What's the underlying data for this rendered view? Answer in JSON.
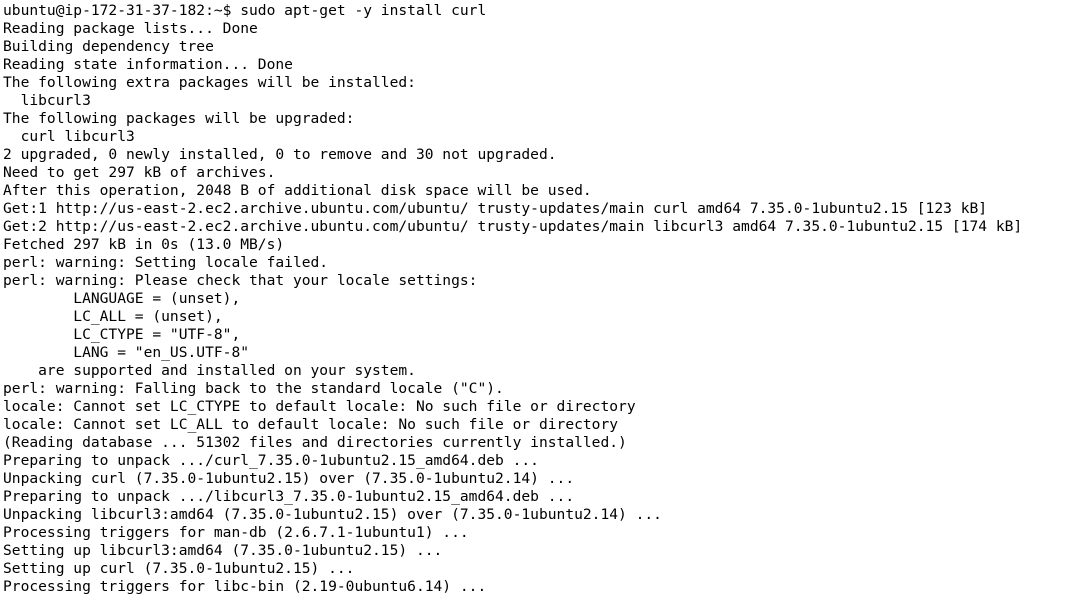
{
  "terminal": {
    "lines": [
      "ubuntu@ip-172-31-37-182:~$ sudo apt-get -y install curl",
      "Reading package lists... Done",
      "Building dependency tree",
      "Reading state information... Done",
      "The following extra packages will be installed:",
      "  libcurl3",
      "The following packages will be upgraded:",
      "  curl libcurl3",
      "2 upgraded, 0 newly installed, 0 to remove and 30 not upgraded.",
      "Need to get 297 kB of archives.",
      "After this operation, 2048 B of additional disk space will be used.",
      "Get:1 http://us-east-2.ec2.archive.ubuntu.com/ubuntu/ trusty-updates/main curl amd64 7.35.0-1ubuntu2.15 [123 kB]",
      "Get:2 http://us-east-2.ec2.archive.ubuntu.com/ubuntu/ trusty-updates/main libcurl3 amd64 7.35.0-1ubuntu2.15 [174 kB]",
      "Fetched 297 kB in 0s (13.0 MB/s)",
      "perl: warning: Setting locale failed.",
      "perl: warning: Please check that your locale settings:",
      "        LANGUAGE = (unset),",
      "        LC_ALL = (unset),",
      "        LC_CTYPE = \"UTF-8\",",
      "        LANG = \"en_US.UTF-8\"",
      "    are supported and installed on your system.",
      "perl: warning: Falling back to the standard locale (\"C\").",
      "locale: Cannot set LC_CTYPE to default locale: No such file or directory",
      "locale: Cannot set LC_ALL to default locale: No such file or directory",
      "(Reading database ... 51302 files and directories currently installed.)",
      "Preparing to unpack .../curl_7.35.0-1ubuntu2.15_amd64.deb ...",
      "Unpacking curl (7.35.0-1ubuntu2.15) over (7.35.0-1ubuntu2.14) ...",
      "Preparing to unpack .../libcurl3_7.35.0-1ubuntu2.15_amd64.deb ...",
      "Unpacking libcurl3:amd64 (7.35.0-1ubuntu2.15) over (7.35.0-1ubuntu2.14) ...",
      "Processing triggers for man-db (2.6.7.1-1ubuntu1) ...",
      "Setting up libcurl3:amd64 (7.35.0-1ubuntu2.15) ...",
      "Setting up curl (7.35.0-1ubuntu2.15) ...",
      "Processing triggers for libc-bin (2.19-0ubuntu6.14) ..."
    ]
  }
}
